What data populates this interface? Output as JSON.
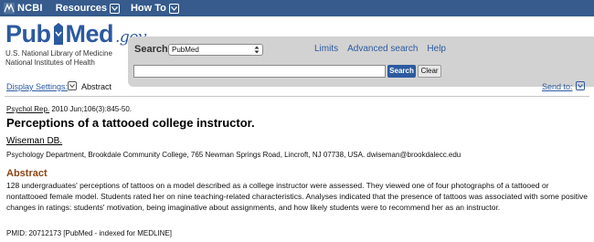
{
  "topbar": {
    "brand": "NCBI",
    "menus": [
      {
        "label": "Resources"
      },
      {
        "label": "How To"
      }
    ]
  },
  "header": {
    "logo": {
      "pub": "Pub",
      "med": "Med",
      "gov": ".gov"
    },
    "library_line1": "U.S. National Library of Medicine",
    "library_line2": "National Institutes of Health"
  },
  "search": {
    "label": "Search:",
    "database": "PubMed",
    "links": [
      "Limits",
      "Advanced search",
      "Help"
    ],
    "query": "",
    "search_button": "Search",
    "clear_button": "Clear"
  },
  "settings": {
    "display_settings_label": "Display Settings:",
    "display_value": "Abstract",
    "send_to_label": "Send to:"
  },
  "article": {
    "citation_journal": "Psychol Rep.",
    "citation_rest": "2010 Jun;106(3):845-50.",
    "title": "Perceptions of a tattooed college instructor.",
    "author": "Wiseman DB.",
    "affiliation": "Psychology Department, Brookdale Community College, 765 Newman Springs Road, Lincroft, NJ 07738, USA. dwiseman@brookdalecc.edu",
    "abstract_heading": "Abstract",
    "abstract_text": "128 undergraduates' perceptions of tattoos on a model described as a college instructor were assessed. They viewed one of four photographs of a tattooed or nontattooed female model. Students rated her on nine teaching-related characteristics. Analyses indicated that the presence of tattoos was associated with some positive changes in ratings: students' motivation, being imaginative about assignments, and how likely students were to recommend her as an instructor.",
    "pmid": "PMID: 20712173 [PubMed - indexed for MEDLINE]"
  },
  "colors": {
    "topbar": "#365b8c",
    "link": "#2c5aa0",
    "abstract_heading": "#8b4513",
    "search_panel": "#d2d2d2"
  }
}
